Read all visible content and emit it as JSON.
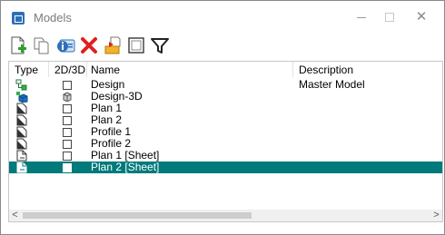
{
  "window": {
    "title": "Models",
    "controls": [
      "minimize",
      "maximize",
      "close"
    ],
    "close_glyph": "✕"
  },
  "toolbar": {
    "buttons": [
      {
        "name": "new-model-button",
        "icon": "new-document-icon"
      },
      {
        "name": "copy-model-button",
        "icon": "copy-icon"
      },
      {
        "name": "model-properties-button",
        "icon": "properties-icon"
      },
      {
        "name": "delete-model-button",
        "icon": "delete-icon"
      },
      {
        "name": "import-model-button",
        "icon": "import-icon"
      },
      {
        "name": "view-mode-button",
        "icon": "frame-icon"
      },
      {
        "name": "filter-button",
        "icon": "filter-icon"
      }
    ]
  },
  "table": {
    "columns": {
      "type": "Type",
      "dim": "2D/3D",
      "name": "Name",
      "description": "Description"
    },
    "rows": [
      {
        "type_icon": "design-model-icon",
        "dim": "2D",
        "name": "Design",
        "description": "Master Model",
        "selected": false
      },
      {
        "type_icon": "3d-model-icon",
        "dim": "3D",
        "name": "Design-3D",
        "description": "",
        "selected": false
      },
      {
        "type_icon": "drawing-model-icon",
        "dim": "2D",
        "name": "Plan 1",
        "description": "",
        "selected": false
      },
      {
        "type_icon": "drawing-model-icon",
        "dim": "2D",
        "name": "Plan 2",
        "description": "",
        "selected": false
      },
      {
        "type_icon": "drawing-model-icon",
        "dim": "2D",
        "name": "Profile 1",
        "description": "",
        "selected": false
      },
      {
        "type_icon": "drawing-model-icon",
        "dim": "2D",
        "name": "Profile 2",
        "description": "",
        "selected": false
      },
      {
        "type_icon": "sheet-model-icon",
        "dim": "2D",
        "name": "Plan 1 [Sheet]",
        "description": "",
        "selected": false
      },
      {
        "type_icon": "sheet-model-icon",
        "dim": "2D",
        "name": "Plan 2 [Sheet]",
        "description": "",
        "selected": true
      }
    ]
  },
  "scrollbar": {
    "left_arrow": "<",
    "right_arrow": ">"
  },
  "colors": {
    "selection": "#007a7a",
    "accent": "#2f6fb8"
  }
}
